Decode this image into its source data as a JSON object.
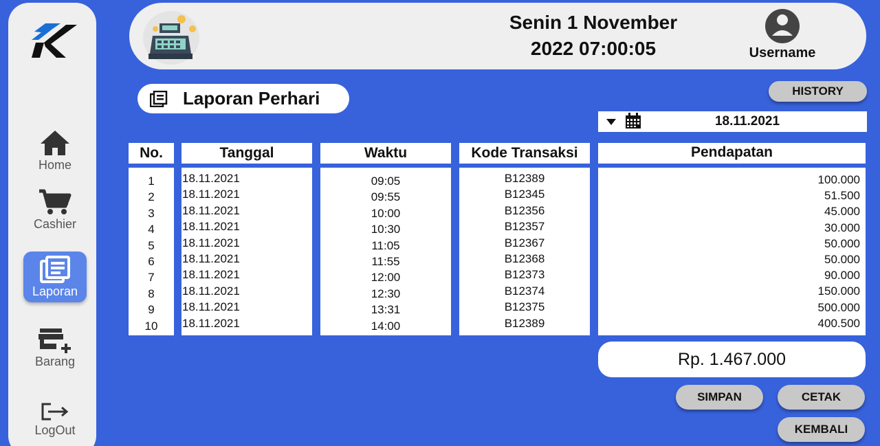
{
  "sidebar": {
    "items": [
      {
        "label": "Home"
      },
      {
        "label": "Cashier"
      },
      {
        "label": "Laporan"
      },
      {
        "label": "Barang"
      },
      {
        "label": "LogOut"
      }
    ]
  },
  "header": {
    "datetime_line1": "Senin 1 November",
    "datetime_line2": "2022 07:00:05",
    "username": "Username"
  },
  "page": {
    "title": "Laporan Perhari",
    "history_label": "HISTORY",
    "date_filter": "18.11.2021"
  },
  "table": {
    "headers": [
      "No.",
      "Tanggal",
      "Waktu",
      "Kode Transaksi",
      "Pendapatan"
    ],
    "rows": [
      {
        "no": "1",
        "tanggal": "18.11.2021",
        "waktu": "09:05",
        "kode": "B12389",
        "pendapatan": "100.000"
      },
      {
        "no": "2",
        "tanggal": "18.11.2021",
        "waktu": "09:55",
        "kode": "B12345",
        "pendapatan": "51.500"
      },
      {
        "no": "3",
        "tanggal": "18.11.2021",
        "waktu": "10:00",
        "kode": "B12356",
        "pendapatan": "45.000"
      },
      {
        "no": "4",
        "tanggal": "18.11.2021",
        "waktu": "10:30",
        "kode": "B12357",
        "pendapatan": "30.000"
      },
      {
        "no": "5",
        "tanggal": "18.11.2021",
        "waktu": "11:05",
        "kode": "B12367",
        "pendapatan": "50.000"
      },
      {
        "no": "6",
        "tanggal": "18.11.2021",
        "waktu": "11:55",
        "kode": "B12368",
        "pendapatan": "50.000"
      },
      {
        "no": "7",
        "tanggal": "18.11.2021",
        "waktu": "12:00",
        "kode": "B12373",
        "pendapatan": "90.000"
      },
      {
        "no": "8",
        "tanggal": "18.11.2021",
        "waktu": "12:30",
        "kode": "B12374",
        "pendapatan": "150.000"
      },
      {
        "no": "9",
        "tanggal": "18.11.2021",
        "waktu": "13:31",
        "kode": "B12375",
        "pendapatan": "500.000"
      },
      {
        "no": "10",
        "tanggal": "18.11.2021",
        "waktu": "14:00",
        "kode": "B12389",
        "pendapatan": "400.500"
      }
    ]
  },
  "footer": {
    "total": "Rp. 1.467.000",
    "simpan_label": "SIMPAN",
    "cetak_label": "CETAK",
    "kembali_label": "KEMBALI"
  },
  "colors": {
    "background": "#3762dc",
    "panel": "#efefef",
    "active_nav": "#5b85e8",
    "button": "#c8c8c8"
  },
  "icons": [
    "logo-k",
    "home-icon",
    "cart-icon",
    "report-icon",
    "store-add-icon",
    "logout-icon",
    "cash-register-icon",
    "user-icon",
    "document-list-icon",
    "dropdown-arrow-icon",
    "calendar-icon"
  ]
}
